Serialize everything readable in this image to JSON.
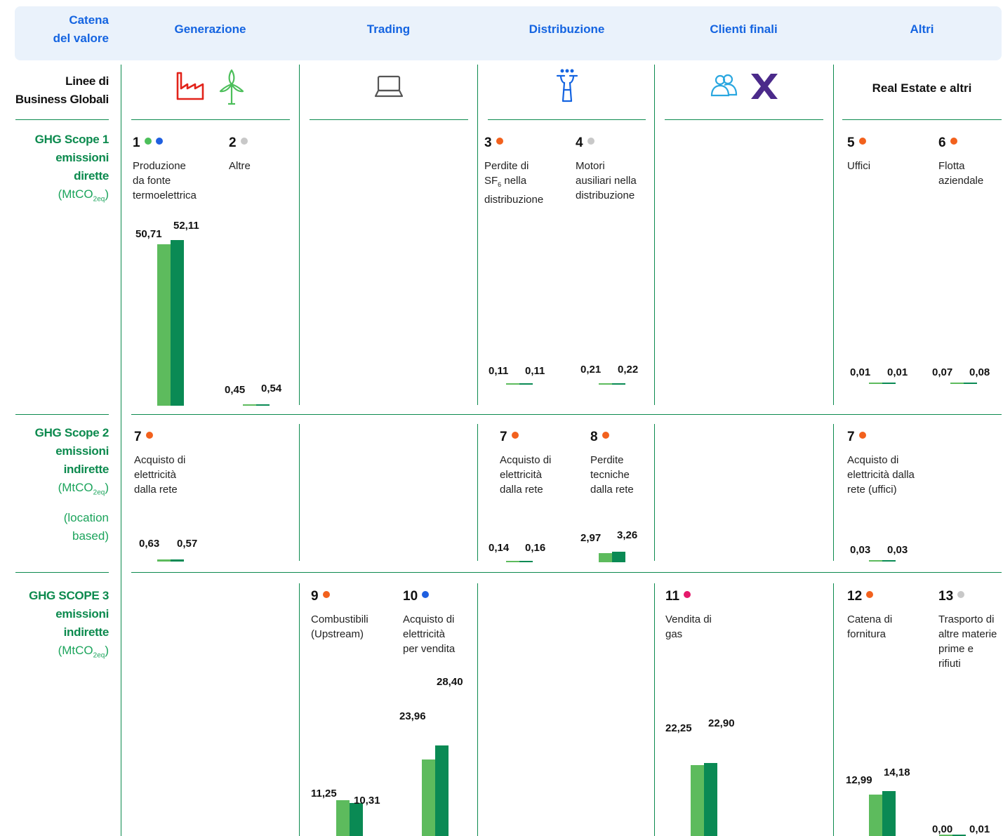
{
  "header": {
    "row_title": "Catena\ndel valore",
    "columns": [
      "Generazione",
      "Trading",
      "Distribuzione",
      "Clienti finali",
      "Altri"
    ]
  },
  "business_row": {
    "label": "Linee di\nBusiness Globali",
    "altri_label": "Real Estate e altri",
    "icons": [
      "factory-icon",
      "wind-turbine-icon",
      "laptop-icon",
      "network-tower-icon",
      "users-icon",
      "x-mark-icon"
    ]
  },
  "rows": [
    {
      "title": "GHG Scope 1\nemissioni\ndirette",
      "unit": "(MtCO",
      "unit_sub": "2eq",
      "unit_end": ")",
      "extra": ""
    },
    {
      "title": "GHG Scope 2\nemissioni\nindirette",
      "unit": "(MtCO",
      "unit_sub": "2eq",
      "unit_end": ")",
      "extra": "(location\nbased)"
    },
    {
      "title": "GHG SCOPE 3\nemissioni\nindirette",
      "unit": "(MtCO",
      "unit_sub": "2eq",
      "unit_end": ")",
      "extra": ""
    }
  ],
  "colors": {
    "bar_previous": "#5dbb5d",
    "bar_current": "#0a8a54",
    "dot_green": "#4cbf5a",
    "dot_blue": "#1f5fe0",
    "dot_grey": "#c8c8c8",
    "dot_orange": "#f2611d",
    "dot_pink": "#e5196b"
  },
  "chart_data": {
    "type": "bar",
    "categories_per_item": 2,
    "items": [
      {
        "num": "1",
        "dots": [
          "dot_green",
          "dot_blue"
        ],
        "desc": "Produzione\nda fonte\ntermoelettrica",
        "values": [
          50.71,
          52.11
        ],
        "labels": [
          "50,71",
          "52,11"
        ]
      },
      {
        "num": "2",
        "dots": [
          "dot_grey"
        ],
        "desc": "Altre",
        "values": [
          0.45,
          0.54
        ],
        "labels": [
          "0,45",
          "0,54"
        ]
      },
      {
        "num": "3",
        "dots": [
          "dot_orange"
        ],
        "desc": "Perdite di\nSF6 nella\ndistribuzione",
        "values": [
          0.11,
          0.11
        ],
        "labels": [
          "0,11",
          "0,11"
        ]
      },
      {
        "num": "4",
        "dots": [
          "dot_grey"
        ],
        "desc": "Motori\nausiliari nella\ndistribuzione",
        "values": [
          0.21,
          0.22
        ],
        "labels": [
          "0,21",
          "0,22"
        ]
      },
      {
        "num": "5",
        "dots": [
          "dot_orange"
        ],
        "desc": "Uffici",
        "values": [
          0.01,
          0.01
        ],
        "labels": [
          "0,01",
          "0,01"
        ]
      },
      {
        "num": "6",
        "dots": [
          "dot_orange"
        ],
        "desc": "Flotta\naziendale",
        "values": [
          0.07,
          0.08
        ],
        "labels": [
          "0,07",
          "0,08"
        ]
      },
      {
        "num": "7",
        "dots": [
          "dot_orange"
        ],
        "desc": "Acquisto di\nelettricità\ndalla rete",
        "values": [
          0.63,
          0.57
        ],
        "labels": [
          "0,63",
          "0,57"
        ]
      },
      {
        "num": "7",
        "dots": [
          "dot_orange"
        ],
        "desc": "Acquisto di\nelettricità\ndalla rete",
        "values": [
          0.14,
          0.16
        ],
        "labels": [
          "0,14",
          "0,16"
        ]
      },
      {
        "num": "8",
        "dots": [
          "dot_orange"
        ],
        "desc": "Perdite\ntecniche\ndalla rete",
        "values": [
          2.97,
          3.26
        ],
        "labels": [
          "2,97",
          "3,26"
        ]
      },
      {
        "num": "7",
        "dots": [
          "dot_orange"
        ],
        "desc": "Acquisto di\nelettricità dalla\nrete (uffici)",
        "values": [
          0.03,
          0.03
        ],
        "labels": [
          "0,03",
          "0,03"
        ]
      },
      {
        "num": "9",
        "dots": [
          "dot_orange"
        ],
        "desc": "Combustibili\n(Upstream)",
        "values": [
          11.25,
          10.31
        ],
        "labels": [
          "11,25",
          "10,31"
        ]
      },
      {
        "num": "10",
        "dots": [
          "dot_blue"
        ],
        "desc": "Acquisto di\nelettricità\nper vendita",
        "values": [
          23.96,
          28.4
        ],
        "labels": [
          "23,96",
          "28,40"
        ]
      },
      {
        "num": "11",
        "dots": [
          "dot_pink"
        ],
        "desc": "Vendita di\ngas",
        "values": [
          22.25,
          22.9
        ],
        "labels": [
          "22,25",
          "22,90"
        ]
      },
      {
        "num": "12",
        "dots": [
          "dot_orange"
        ],
        "desc": "Catena di\nfornitura",
        "values": [
          12.99,
          14.18
        ],
        "labels": [
          "12,99",
          "14,18"
        ]
      },
      {
        "num": "13",
        "dots": [
          "dot_grey"
        ],
        "desc": "Trasporto di\naltre materie\nprime e\nrifiuti",
        "values": [
          0.0,
          0.01
        ],
        "labels": [
          "0,00",
          "0,01"
        ]
      }
    ]
  }
}
